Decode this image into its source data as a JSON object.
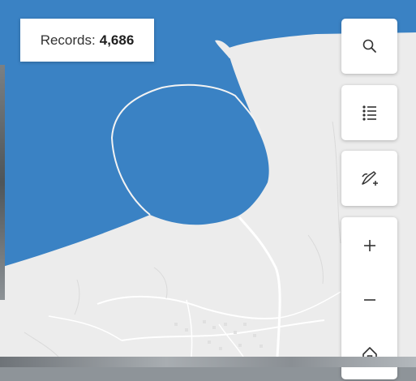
{
  "records": {
    "label": "Records:",
    "value": "4,686"
  },
  "toolbar": {
    "search": {
      "icon": "search-icon"
    },
    "list": {
      "icon": "list-icon"
    },
    "sketch": {
      "icon": "sketch-add-icon"
    }
  },
  "zoom": {
    "zoom_in": {
      "icon": "plus-icon"
    },
    "zoom_out": {
      "icon": "minus-icon"
    },
    "home": {
      "icon": "home-icon"
    }
  },
  "colors": {
    "water": "#3a82c4",
    "land": "#ececec",
    "roads": "#ffffff",
    "icon": "#323232"
  }
}
